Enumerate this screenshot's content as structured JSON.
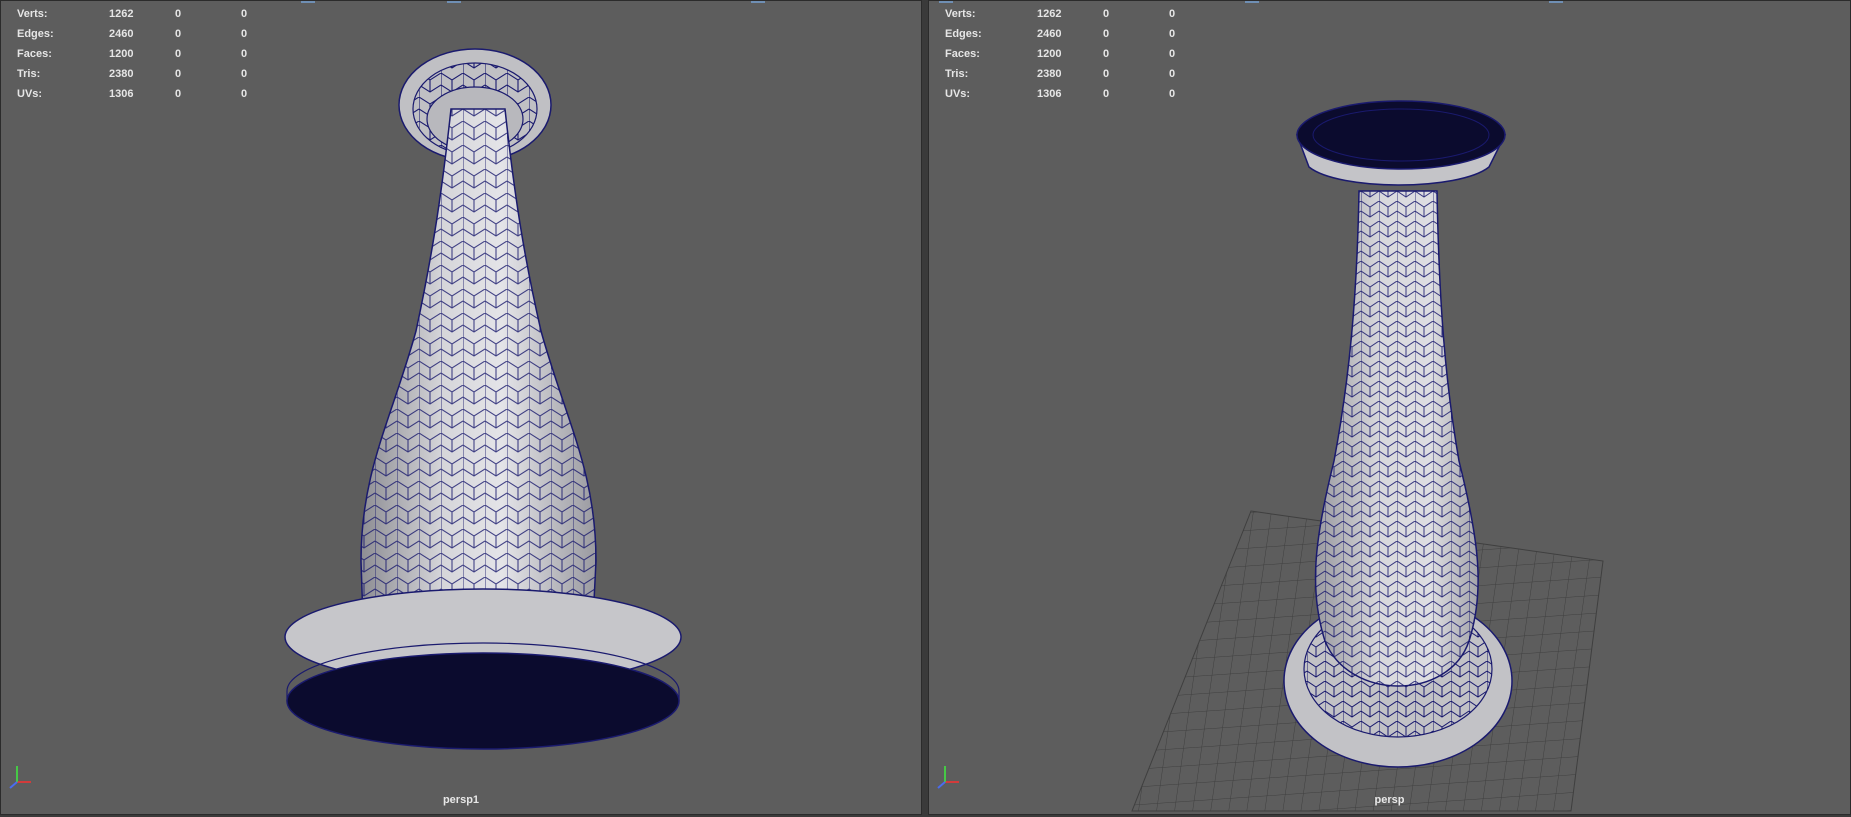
{
  "viewports": [
    {
      "camera_label": "persp1",
      "hud": [
        {
          "label": "Verts:",
          "value": "1262",
          "v1": "0",
          "v2": "0"
        },
        {
          "label": "Edges:",
          "value": "2460",
          "v1": "0",
          "v2": "0"
        },
        {
          "label": "Faces:",
          "value": "1200",
          "v1": "0",
          "v2": "0"
        },
        {
          "label": "Tris:",
          "value": "2380",
          "v1": "0",
          "v2": "0"
        },
        {
          "label": "UVs:",
          "value": "1306",
          "v1": "0",
          "v2": "0"
        }
      ]
    },
    {
      "camera_label": "persp",
      "hud": [
        {
          "label": "Verts:",
          "value": "1262",
          "v1": "0",
          "v2": "0"
        },
        {
          "label": "Edges:",
          "value": "2460",
          "v1": "0",
          "v2": "0"
        },
        {
          "label": "Faces:",
          "value": "1200",
          "v1": "0",
          "v2": "0"
        },
        {
          "label": "Tris:",
          "value": "2380",
          "v1": "0",
          "v2": "0"
        },
        {
          "label": "UVs:",
          "value": "1306",
          "v1": "0",
          "v2": "0"
        }
      ]
    }
  ],
  "colors": {
    "viewport_bg": "#5d5d5d",
    "wireframe": "#1a1a6e",
    "mesh_fill": "#c8c8cc",
    "grid": "#3f3f3f",
    "axis_x": "#d23b3b",
    "axis_y": "#46c846",
    "axis_z": "#4a6cf0"
  },
  "icons": {
    "axis_indicator": "axis-gizmo-icon"
  }
}
